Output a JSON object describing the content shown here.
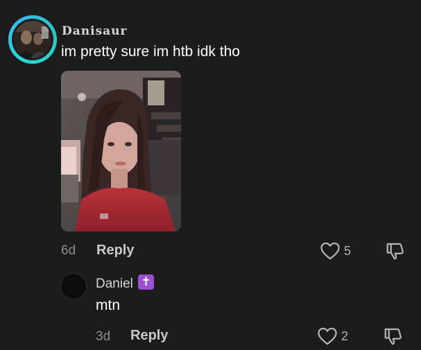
{
  "comment": {
    "username": "Danisaur",
    "text": "im pretty sure im htb idk tho",
    "time": "6d",
    "reply_label": "Reply",
    "likes": "5",
    "avatar_ring_color": "#2bd9d0",
    "icons": [
      "heart-outline-icon",
      "thumbs-down-icon"
    ]
  },
  "reply": {
    "username": "Daniel",
    "badge_symbol": "✝",
    "badge_color": "#9b4fd1",
    "text": "mtn",
    "time": "3d",
    "reply_label": "Reply",
    "likes": "2",
    "icons": [
      "heart-outline-icon",
      "thumbs-down-icon"
    ]
  },
  "colors": {
    "background": "#1c1c1c",
    "text_primary": "#ffffff",
    "text_secondary": "#8c8c8c"
  }
}
